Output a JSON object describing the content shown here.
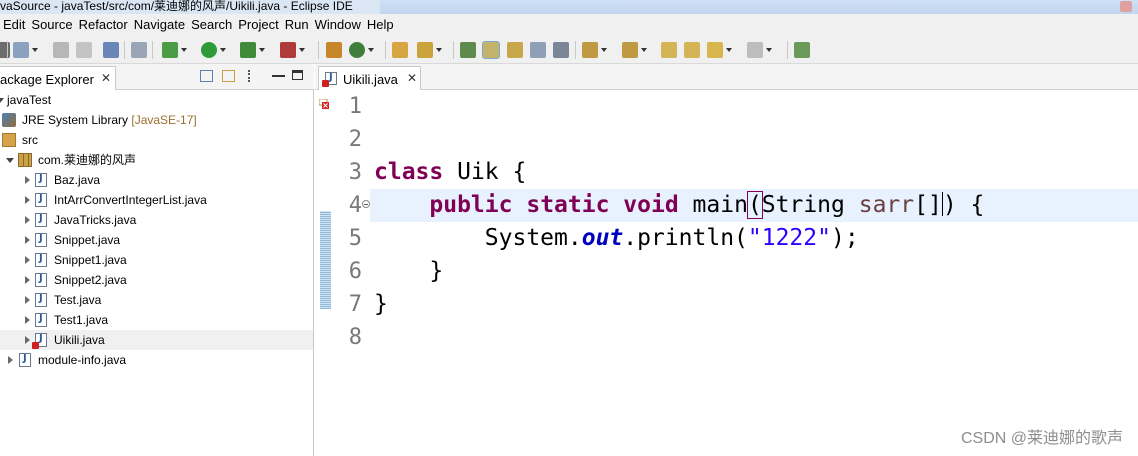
{
  "window": {
    "title": "vaSource - javaTest/src/com/莱迪娜的风声/Uikili.java - Eclipse IDE"
  },
  "menu": [
    "Edit",
    "Source",
    "Refactor",
    "Navigate",
    "Search",
    "Project",
    "Run",
    "Window",
    "Help"
  ],
  "package_explorer": {
    "tab_label": "ackage Explorer",
    "tree": [
      {
        "label": "javaTest",
        "level": 0
      },
      {
        "label": "JRE System Library",
        "decoration": "[JavaSE-17]",
        "level": 1
      },
      {
        "label": "src",
        "level": 1
      },
      {
        "label": "com.莱迪娜的风声",
        "level": 2
      },
      {
        "label": "Baz.java",
        "level": 3
      },
      {
        "label": "IntArrConvertIntegerList.java",
        "level": 3
      },
      {
        "label": "JavaTricks.java",
        "level": 3
      },
      {
        "label": "Snippet.java",
        "level": 3
      },
      {
        "label": "Snippet1.java",
        "level": 3
      },
      {
        "label": "Snippet2.java",
        "level": 3
      },
      {
        "label": "Test.java",
        "level": 3
      },
      {
        "label": "Test1.java",
        "level": 3
      },
      {
        "label": "Uikili.java",
        "level": 3,
        "selected": true,
        "error": true
      },
      {
        "label": "module-info.java",
        "level": 2
      }
    ]
  },
  "editor": {
    "tab_label": "Uikili.java",
    "line_numbers": [
      "1",
      "2",
      "3",
      "4",
      "5",
      "6",
      "7",
      "8"
    ],
    "code": {
      "l3_kw": "class",
      "l3_rest": " Uik {",
      "l4_indent": "    ",
      "l4_kw1": "public",
      "l4_kw2": "static",
      "l4_kw3": "void",
      "l4_name": " main",
      "l4_open": "(",
      "l4_type": "String ",
      "l4_param": "sarr",
      "l4_brackets": "[]",
      "l4_close": ") {",
      "l5_indent": "        ",
      "l5_sys": "System.",
      "l5_out": "out",
      "l5_call": ".println(",
      "l5_str": "\"1222\"",
      "l5_end": ");",
      "l6": "    }",
      "l7": "}"
    }
  },
  "watermark": "CSDN @莱迪娜的歌声"
}
